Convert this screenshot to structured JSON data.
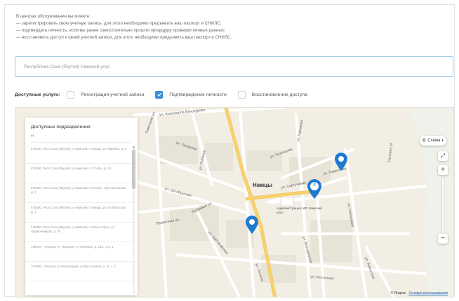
{
  "intro": {
    "line1": "В центрах обслуживания вы можете:",
    "line2": "— зарегистрировать свою учетную запись, для этого необходимо предъявить ваш паспорт и СНИЛС;",
    "line3": "— подтвердить личность, если вы ранее самостоятельно прошли процедуру проверки личных данных;",
    "line4": "— восстановить доступ к своей учетной записи, для этого необходимо предъявить ваш паспорт и СНИЛС."
  },
  "search": {
    "placeholder": "Республика Саха (Якутия) Намский улус"
  },
  "services": {
    "label": "Доступные услуги:",
    "items": [
      {
        "label": "Регистрация учетной записи",
        "checked": false
      },
      {
        "label": "Подтверждение личности",
        "checked": true
      },
      {
        "label": "Восстановление доступа",
        "checked": false
      }
    ]
  },
  "branches": {
    "title": "Доступные подразделения",
    "filter": "Н",
    "items": [
      "678380, Респ Саха (Якутия), у Намский, с Намцы, ул Чиряева, д. 5",
      "678380, Респ Саха (Якутия), у Намский, с Столбы, д. 34",
      "678380, Респ Саха (Якутия), у Намский, с Столбы, пер Николаева, д. 2",
      "678380, Респ Саха (Якутия), у Намский, с Намцы, ул Октябрьская, д. 1",
      "678380, Респ Саха (Якутия), у Намский, с Хатын-Юрях, ул Орджоникидзе, д. 30",
      "125009, г Москва, ул Тверская, ул Моховая, д. 15/1, стр. 1",
      "107996, г Москва, ул Кооперации, ул Бессонкина, д. 11, к. 1"
    ]
  },
  "map": {
    "city_label": "Намцы",
    "admin_label": "Администрация МО Намский улус",
    "streets": [
      "ул. Комсомола Винокурова",
      "Советская ул.",
      "ул. Захарова",
      "ул. Рыбаков",
      "ул. Октябрьская",
      "ул. Ленина",
      "ул. Хаптагайская",
      "Приречная ул.",
      "ул. Сергучаева",
      "ул. Гаврилова",
      "ул. Молодёжная",
      "ул. Колхозная",
      "ул. Чурнаева",
      "Рыбацкая ул.",
      "ул. Кузнецова",
      "ул. Николаева",
      "ул. Аммосова",
      "Полевая ул."
    ],
    "cluster_count": "2",
    "scheme_label": "Схема",
    "zoom_in": "+",
    "zoom_out": "−",
    "credit_logo": "© Яндекс",
    "credit_link": "Условия использования"
  },
  "colors": {
    "accent": "#3b8fdc",
    "pin": "#1f7ad1",
    "road_main": "#f7d36c",
    "road_secondary": "#ffffff",
    "map_bg": "#f2eee4"
  },
  "icons": {
    "checkbox_checked": "check-icon",
    "layers": "layers-icon",
    "fullscreen": "fullscreen-icon",
    "pin": "map-pin-icon"
  }
}
